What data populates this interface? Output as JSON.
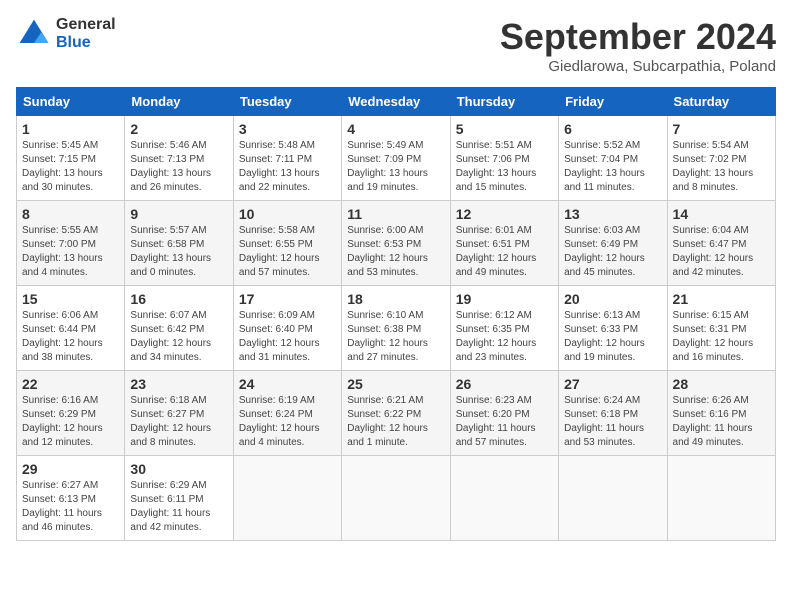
{
  "logo": {
    "general": "General",
    "blue": "Blue"
  },
  "header": {
    "month": "September 2024",
    "location": "Giedlarowa, Subcarpathia, Poland"
  },
  "days_of_week": [
    "Sunday",
    "Monday",
    "Tuesday",
    "Wednesday",
    "Thursday",
    "Friday",
    "Saturday"
  ],
  "weeks": [
    [
      {
        "day": "1",
        "sunrise": "5:45 AM",
        "sunset": "7:15 PM",
        "daylight": "13 hours and 30 minutes."
      },
      {
        "day": "2",
        "sunrise": "5:46 AM",
        "sunset": "7:13 PM",
        "daylight": "13 hours and 26 minutes."
      },
      {
        "day": "3",
        "sunrise": "5:48 AM",
        "sunset": "7:11 PM",
        "daylight": "13 hours and 22 minutes."
      },
      {
        "day": "4",
        "sunrise": "5:49 AM",
        "sunset": "7:09 PM",
        "daylight": "13 hours and 19 minutes."
      },
      {
        "day": "5",
        "sunrise": "5:51 AM",
        "sunset": "7:06 PM",
        "daylight": "13 hours and 15 minutes."
      },
      {
        "day": "6",
        "sunrise": "5:52 AM",
        "sunset": "7:04 PM",
        "daylight": "13 hours and 11 minutes."
      },
      {
        "day": "7",
        "sunrise": "5:54 AM",
        "sunset": "7:02 PM",
        "daylight": "13 hours and 8 minutes."
      }
    ],
    [
      {
        "day": "8",
        "sunrise": "5:55 AM",
        "sunset": "7:00 PM",
        "daylight": "13 hours and 4 minutes."
      },
      {
        "day": "9",
        "sunrise": "5:57 AM",
        "sunset": "6:58 PM",
        "daylight": "13 hours and 0 minutes."
      },
      {
        "day": "10",
        "sunrise": "5:58 AM",
        "sunset": "6:55 PM",
        "daylight": "12 hours and 57 minutes."
      },
      {
        "day": "11",
        "sunrise": "6:00 AM",
        "sunset": "6:53 PM",
        "daylight": "12 hours and 53 minutes."
      },
      {
        "day": "12",
        "sunrise": "6:01 AM",
        "sunset": "6:51 PM",
        "daylight": "12 hours and 49 minutes."
      },
      {
        "day": "13",
        "sunrise": "6:03 AM",
        "sunset": "6:49 PM",
        "daylight": "12 hours and 45 minutes."
      },
      {
        "day": "14",
        "sunrise": "6:04 AM",
        "sunset": "6:47 PM",
        "daylight": "12 hours and 42 minutes."
      }
    ],
    [
      {
        "day": "15",
        "sunrise": "6:06 AM",
        "sunset": "6:44 PM",
        "daylight": "12 hours and 38 minutes."
      },
      {
        "day": "16",
        "sunrise": "6:07 AM",
        "sunset": "6:42 PM",
        "daylight": "12 hours and 34 minutes."
      },
      {
        "day": "17",
        "sunrise": "6:09 AM",
        "sunset": "6:40 PM",
        "daylight": "12 hours and 31 minutes."
      },
      {
        "day": "18",
        "sunrise": "6:10 AM",
        "sunset": "6:38 PM",
        "daylight": "12 hours and 27 minutes."
      },
      {
        "day": "19",
        "sunrise": "6:12 AM",
        "sunset": "6:35 PM",
        "daylight": "12 hours and 23 minutes."
      },
      {
        "day": "20",
        "sunrise": "6:13 AM",
        "sunset": "6:33 PM",
        "daylight": "12 hours and 19 minutes."
      },
      {
        "day": "21",
        "sunrise": "6:15 AM",
        "sunset": "6:31 PM",
        "daylight": "12 hours and 16 minutes."
      }
    ],
    [
      {
        "day": "22",
        "sunrise": "6:16 AM",
        "sunset": "6:29 PM",
        "daylight": "12 hours and 12 minutes."
      },
      {
        "day": "23",
        "sunrise": "6:18 AM",
        "sunset": "6:27 PM",
        "daylight": "12 hours and 8 minutes."
      },
      {
        "day": "24",
        "sunrise": "6:19 AM",
        "sunset": "6:24 PM",
        "daylight": "12 hours and 4 minutes."
      },
      {
        "day": "25",
        "sunrise": "6:21 AM",
        "sunset": "6:22 PM",
        "daylight": "12 hours and 1 minute."
      },
      {
        "day": "26",
        "sunrise": "6:23 AM",
        "sunset": "6:20 PM",
        "daylight": "11 hours and 57 minutes."
      },
      {
        "day": "27",
        "sunrise": "6:24 AM",
        "sunset": "6:18 PM",
        "daylight": "11 hours and 53 minutes."
      },
      {
        "day": "28",
        "sunrise": "6:26 AM",
        "sunset": "6:16 PM",
        "daylight": "11 hours and 49 minutes."
      }
    ],
    [
      {
        "day": "29",
        "sunrise": "6:27 AM",
        "sunset": "6:13 PM",
        "daylight": "11 hours and 46 minutes."
      },
      {
        "day": "30",
        "sunrise": "6:29 AM",
        "sunset": "6:11 PM",
        "daylight": "11 hours and 42 minutes."
      },
      null,
      null,
      null,
      null,
      null
    ]
  ]
}
